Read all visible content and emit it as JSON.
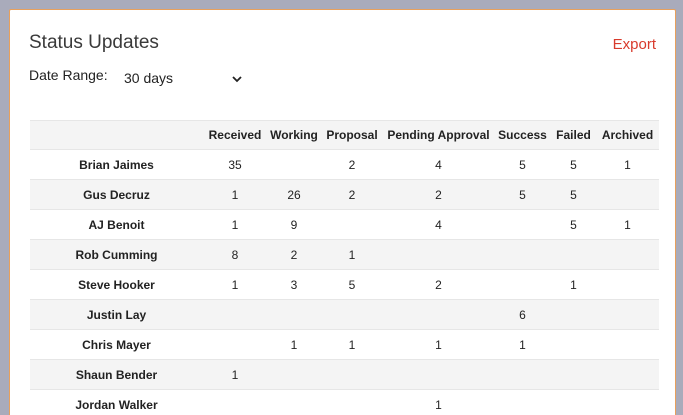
{
  "header": {
    "title": "Status Updates",
    "export_label": "Export"
  },
  "filter": {
    "label": "Date Range:",
    "selected": "30 days"
  },
  "table": {
    "columns": [
      "",
      "Received",
      "Working",
      "Proposal",
      "Pending Approval",
      "Success",
      "Failed",
      "Archived"
    ],
    "rows": [
      {
        "name": "Brian Jaimes",
        "values": [
          "35",
          "",
          "2",
          "4",
          "5",
          "5",
          "1"
        ]
      },
      {
        "name": "Gus Decruz",
        "values": [
          "1",
          "26",
          "2",
          "2",
          "5",
          "5",
          ""
        ]
      },
      {
        "name": "AJ Benoit",
        "values": [
          "1",
          "9",
          "",
          "4",
          "",
          "5",
          "1"
        ]
      },
      {
        "name": "Rob Cumming",
        "values": [
          "8",
          "2",
          "1",
          "",
          "",
          "",
          ""
        ]
      },
      {
        "name": "Steve Hooker",
        "values": [
          "1",
          "3",
          "5",
          "2",
          "",
          "1",
          ""
        ]
      },
      {
        "name": "Justin Lay",
        "values": [
          "",
          "",
          "",
          "",
          "6",
          "",
          ""
        ]
      },
      {
        "name": "Chris Mayer",
        "values": [
          "",
          "1",
          "1",
          "1",
          "1",
          "",
          ""
        ]
      },
      {
        "name": "Shaun Bender",
        "values": [
          "1",
          "",
          "",
          "",
          "",
          "",
          ""
        ]
      },
      {
        "name": "Jordan Walker",
        "values": [
          "",
          "",
          "",
          "1",
          "",
          "",
          ""
        ]
      }
    ]
  },
  "colors": {
    "accent": "#d83a2c",
    "card_border": "#e8a05c",
    "background": "#a9abbb"
  }
}
